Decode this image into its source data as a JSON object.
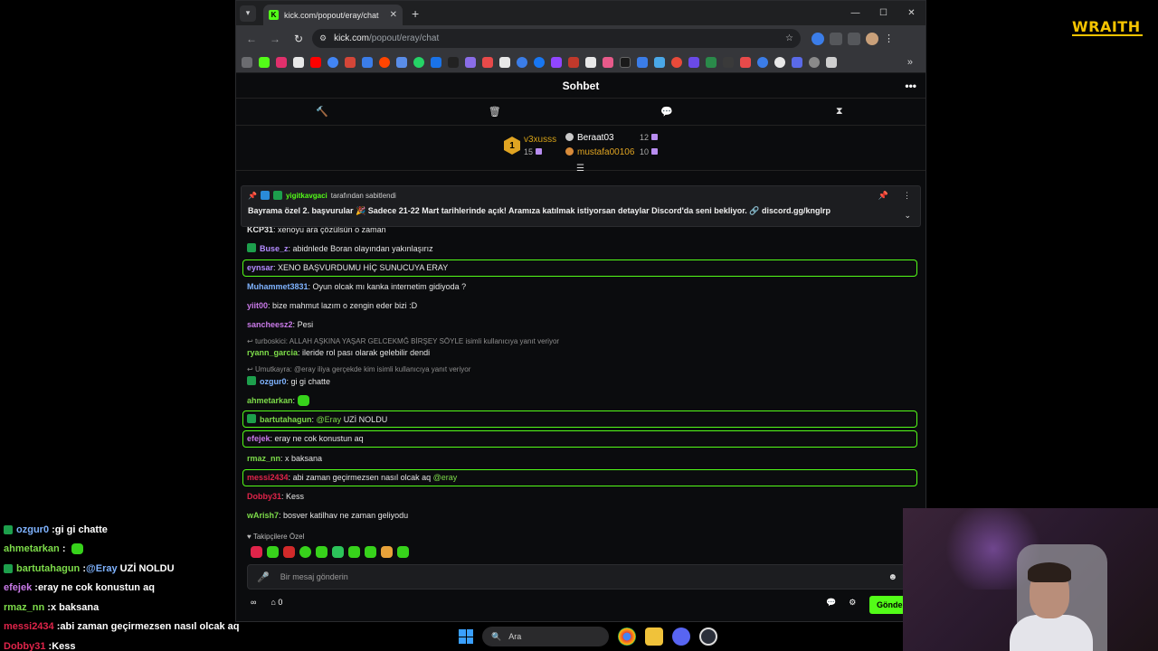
{
  "browser": {
    "tab_title": "kick.com/popout/eray/chat",
    "tab_fav": "K",
    "url_host": "kick.com",
    "url_path": "/popout/eray/chat"
  },
  "chat": {
    "title": "Sohbet",
    "leaderboard": {
      "first_rank": "1",
      "first_name": "v3xusss",
      "first_count": "15",
      "second_name": "Beraat03",
      "second_count": "12",
      "third_name": "mustafa00106",
      "third_count": "10"
    },
    "pinned": {
      "user": "yigitkavgaci",
      "suffix": "tarafından sabitlendi",
      "text": "Bayrama özel 2. başvurular 🎉 Sadece 21-22 Mart tarihlerinde açık! Aramıza katılmak istiyorsan detaylar Discord'da seni bekliyor. 🔗 discord.gg/knglrp"
    },
    "messages": [
      {
        "user": "KCP31",
        "color": "#e6e6e6",
        "text": "xenoyu ara çözülsün o zaman"
      },
      {
        "user": "Buse_z",
        "color": "#b48cff",
        "text": "abidnlede Boran olayından yakınlaşırız"
      },
      {
        "user": "eynsar",
        "color": "#b48cff",
        "text": "XENO BAŞVURDUMU HİÇ SUNUCUYA ERAY"
      },
      {
        "user": "Muhammet3831",
        "color": "#7fb3ff",
        "text": "Oyun olcak mı kanka internetim gidiyoda ?"
      },
      {
        "user": "yiit00",
        "color": "#c97ae8",
        "text": "bize mahmut lazım o zengin eder bizi :D"
      },
      {
        "user": "sancheesz2",
        "color": "#c97ae8",
        "text": "Pesi"
      },
      {
        "user": "ryann_garcia",
        "color": "#7ddc4a",
        "text": "ileride rol pası olarak gelebilir dendi"
      },
      {
        "user": "ozgur0",
        "color": "#7fb3ff",
        "text": "gi gi chatte"
      },
      {
        "user": "ahmetarkan",
        "color": "#7ddc4a",
        "text": ""
      },
      {
        "user": "bartutahagun",
        "color": "#7ddc4a",
        "mention": "@Eray",
        "text": "UZİ NOLDU"
      },
      {
        "user": "efejek",
        "color": "#c97ae8",
        "text": "eray ne cok konustun aq"
      },
      {
        "user": "rmaz_nn",
        "color": "#7ddc4a",
        "text": "x baksana"
      },
      {
        "user": "messi2434",
        "color": "#e0244a",
        "text": "abi zaman geçirmezsen nasıl olcak aq",
        "mention": "@eray"
      },
      {
        "user": "Dobby31",
        "color": "#e0244a",
        "text": "Kess"
      },
      {
        "user": "wArish7",
        "color": "#7ddc4a",
        "text": "bosver katilhav ne zaman geliyodu"
      }
    ],
    "replies": [
      "turboskici: ALLAH AŞKINA YAŞAR GELCEKMĞ BİRŞEY SÖYLE isimli kullanıcıya yanıt veriyor",
      "Umutkayra: @eray iliya gerçekde kim isimli kullanıcıya yanıt veriyor"
    ],
    "sub_only": "Takipçilere Özel",
    "input_placeholder": "Bir mesaj gönderin",
    "points": "0",
    "send_label": "Gönder"
  },
  "overlay": {
    "logo": "WRAITH",
    "lines": [
      {
        "user": "ozgur0",
        "color": "#7fb3ff",
        "text": "gi gi chatte"
      },
      {
        "user": "ahmetarkan",
        "color": "#7ddc4a",
        "text": ""
      },
      {
        "user": "bartutahagun",
        "color": "#7ddc4a",
        "mention": "@Eray",
        "text": "UZİ NOLDU"
      },
      {
        "user": "efejek",
        "color": "#c97ae8",
        "text": "eray ne cok konustun aq"
      },
      {
        "user": "rmaz_nn",
        "color": "#7ddc4a",
        "text": "x baksana"
      },
      {
        "user": "messi2434",
        "color": "#e0244a",
        "text": "abi zaman geçirmezsen nasıl olcak aq"
      },
      {
        "user": "Dobby31",
        "color": "#e0244a",
        "text": "Kess"
      }
    ]
  },
  "taskbar": {
    "search_placeholder": "Ara"
  }
}
